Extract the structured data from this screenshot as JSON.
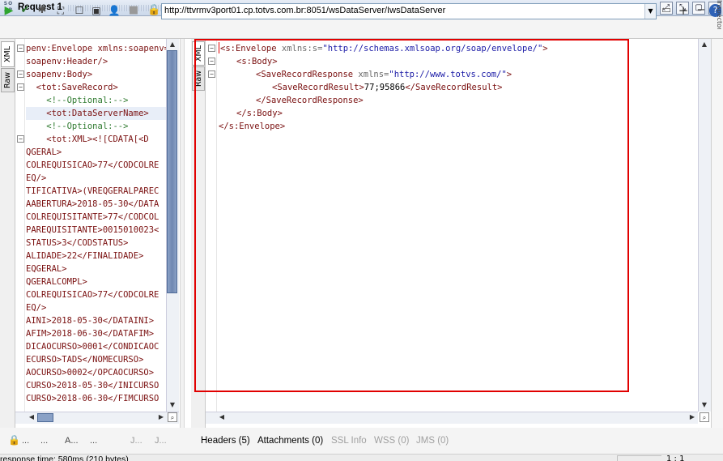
{
  "window": {
    "logo_text": "SO AP",
    "title": "Request 1"
  },
  "toolbar": {
    "endpoint_url": "http://ttvrmv3port01.cp.totvs.com.br:8051/wsDataServer/IwsDataServer"
  },
  "left_panel": {
    "tabs": [
      "XML",
      "Raw"
    ],
    "lines": [
      "penv:Envelope xmlns:soapenv=",
      "soapenv:Header/>",
      "soapenv:Body>",
      "  <tot:SaveRecord>",
      "    <!--Optional:-->",
      "    <tot:DataServerName>",
      "    <!--Optional:-->",
      "    <tot:XML><![CDATA[<D",
      "QGERAL>",
      "COLREQUISICAO>77</CODCOLRE",
      "EQ/>",
      "TIFICATIVA>(VREQGERALPAREC",
      "AABERTURA>2018-05-30</DATA",
      "COLREQUISITANTE>77</CODCOL",
      "PAREQUISITANTE>0015010023<",
      "STATUS>3</CODSTATUS>",
      "ALIDADE>22</FINALIDADE>",
      "EQGERAL>",
      "QGERALCOMPL>",
      "COLREQUISICAO>77</CODCOLRE",
      "EQ/>",
      "AINI>2018-05-30</DATAINI>",
      "AFIM>2018-06-30</DATAFIM>",
      "DICAOCURSO>0001</CONDICAOC",
      "ECURSO>TADS</NOMECURSO>",
      "AOCURSO>0002</OPCAOCURSO>",
      "CURSO>2018-05-30</INICURSO",
      "CURSO>2018-06-30</FIMCURSO"
    ],
    "bottom_tabs": [
      "...",
      "...",
      "A...",
      "...",
      "J...",
      "J..."
    ]
  },
  "right_panel": {
    "tabs": [
      "XML",
      "Raw"
    ],
    "response": {
      "envelope_open_tag": "<s:Envelope",
      "envelope_attr": " xmlns:s=",
      "envelope_ns": "\"http://schemas.xmlsoap.org/soap/envelope/\"",
      "envelope_close": ">",
      "body_open": "<s:Body>",
      "resp_open_tag": "<SaveRecordResponse",
      "resp_attr": " xmlns=",
      "resp_ns": "\"http://www.totvs.com/\"",
      "resp_close": ">",
      "result_open": "<SaveRecordResult>",
      "result_value": "77;95866",
      "result_close": "</SaveRecordResult>",
      "resp_end": "</SaveRecordResponse>",
      "body_close": "</s:Body>",
      "envelope_end": "</s:Envelope>"
    },
    "bottom_tabs": {
      "headers": "Headers (5)",
      "attachments": "Attachments (0)",
      "ssl": "SSL Info",
      "wss": "WSS (0)",
      "jms": "JMS (0)"
    }
  },
  "status": {
    "text": "response time: 580ms (210 bytes)",
    "position": "1 : 1"
  },
  "side_label": "Inspector",
  "colors": {
    "highlight": "#e10000",
    "tag": "#7a1010",
    "value": "#1a1aa6",
    "titlebar": "#cbd8ea"
  }
}
